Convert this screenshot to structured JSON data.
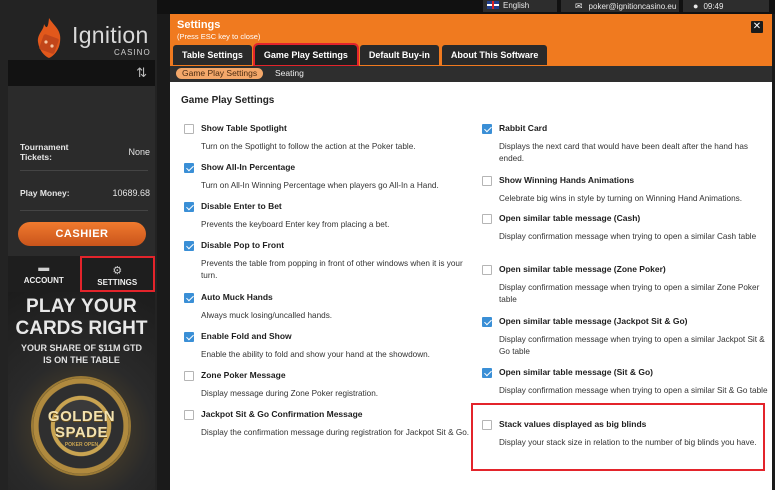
{
  "brand": {
    "name": "Ignition",
    "sub": "CASINO"
  },
  "topbar": {
    "language": "English",
    "email": "poker@ignitioncasino.eu",
    "time": "09:49"
  },
  "sidebar": {
    "tournament_label": "Tournament Tickets:",
    "tournament_value": "None",
    "play_money_label": "Play Money:",
    "play_money_value": "10689.68",
    "cashier_label": "CASHIER",
    "account_label": "ACCOUNT",
    "settings_label": "SETTINGS"
  },
  "promo": {
    "line1": "PLAY YOUR",
    "line2": "CARDS RIGHT",
    "line3": "YOUR SHARE OF $11M GTD",
    "line4": "IS ON THE TABLE",
    "chip1": "GOLDEN",
    "chip2": "SPADE",
    "chip3": "POKER OPEN"
  },
  "settings": {
    "title": "Settings",
    "subtitle": "(Press ESC key to close)",
    "close": "✕",
    "tabs": [
      "Table Settings",
      "Game Play Settings",
      "Default Buy-in",
      "About This Software"
    ],
    "subtabs": [
      "Game Play Settings",
      "Seating"
    ],
    "section_title": "Game Play Settings",
    "left_options": [
      {
        "title": "Show Table Spotlight",
        "desc": "Turn on the Spotlight to follow the action at the Poker table.",
        "checked": false
      },
      {
        "title": "Show All-In Percentage",
        "desc": "Turn on All-In Winning Percentage when players go All-In a Hand.",
        "checked": true
      },
      {
        "title": "Disable Enter to Bet",
        "desc": "Prevents the keyboard Enter key from placing a bet.",
        "checked": true
      },
      {
        "title": "Disable Pop to Front",
        "desc": "Prevents the table from popping in front of other windows when it is your turn.",
        "checked": true
      },
      {
        "title": "Auto Muck Hands",
        "desc": "Always muck losing/uncalled hands.",
        "checked": true
      },
      {
        "title": "Enable Fold and Show",
        "desc": "Enable the ability to fold and show your hand at the showdown.",
        "checked": true
      },
      {
        "title": "Zone Poker Message",
        "desc": "Display message during Zone Poker registration.",
        "checked": false
      },
      {
        "title": "Jackpot Sit & Go Confirmation Message",
        "desc": "Display the confirmation message during registration for Jackpot Sit & Go.",
        "checked": false
      }
    ],
    "right_options": [
      {
        "title": "Rabbit Card",
        "desc": "Displays the next card that would have been dealt after the hand has ended.",
        "checked": true
      },
      {
        "title": "Show Winning Hands Animations",
        "desc": "Celebrate big wins in style by turning on Winning Hand Animations.",
        "checked": false
      },
      {
        "title": "Open similar table message (Cash)",
        "desc": "Display confirmation message when trying to open a similar Cash table",
        "checked": false
      },
      {
        "title": "Open similar table message (Zone Poker)",
        "desc": "Display confirmation message when trying to open a similar Zone Poker table",
        "checked": false
      },
      {
        "title": "Open similar table message (Jackpot Sit & Go)",
        "desc": "Display confirmation message when trying to open a similar Jackpot Sit & Go table",
        "checked": true
      },
      {
        "title": "Open similar table message (Sit & Go)",
        "desc": "Display confirmation message when trying to open a similar Sit & Go table",
        "checked": true
      },
      {
        "title": "Stack values displayed as big blinds",
        "desc": "Display your stack size in relation to the number of big blinds you have.",
        "checked": false
      }
    ]
  },
  "colors": {
    "accent": "#f07a1f",
    "highlight": "#e3242b",
    "checkbox": "#3a8fd6"
  }
}
